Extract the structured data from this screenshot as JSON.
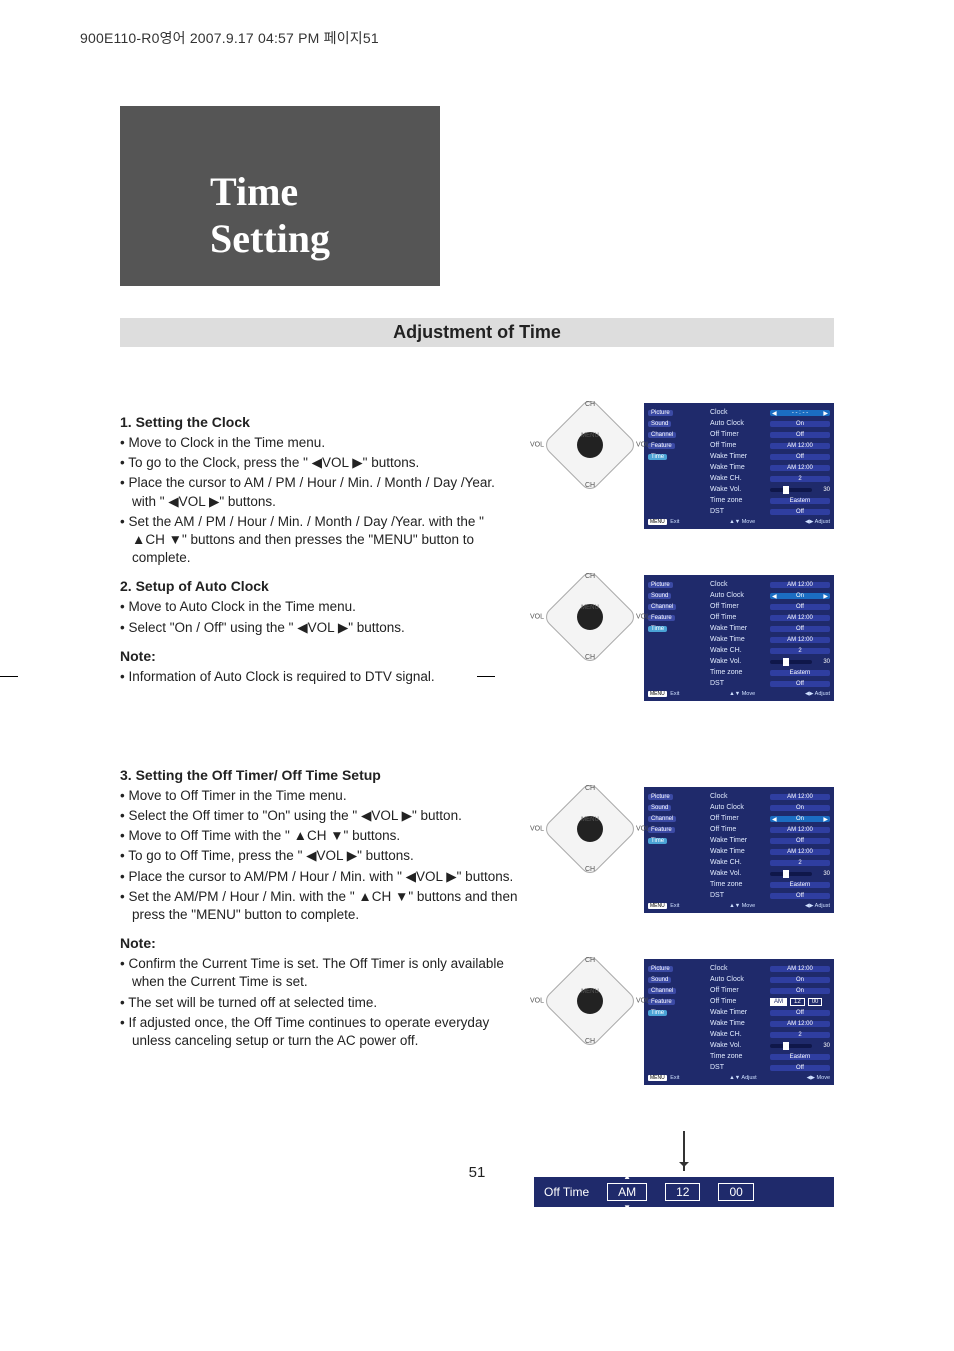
{
  "header_line": "900E110-R0영어  2007.9.17 04:57 PM  페이지51",
  "title": "Time Setting",
  "section_heading": "Adjustment of Time",
  "page_number": "51",
  "remote_labels": {
    "ch_up": "CH",
    "ch_dn": "CH",
    "vol_l": "VOL",
    "vol_r": "VOL",
    "menu": "MENU"
  },
  "step1": {
    "title": "1. Setting the Clock",
    "bullets": [
      "Move to Clock in the Time menu.",
      "To go to the Clock, press the \" ◀VOL ▶\" buttons.",
      "Place the cursor to AM / PM / Hour / Min. / Month / Day /Year. with \" ◀VOL ▶\" buttons.",
      "Set the AM / PM / Hour / Min. / Month / Day /Year. with the \" ▲CH ▼\" buttons and then presses the \"MENU\" button to complete."
    ]
  },
  "step2": {
    "title": "2. Setup of Auto Clock",
    "bullets": [
      "Move to Auto Clock in the Time menu.",
      "Select \"On / Off\" using the  \" ◀VOL ▶\" buttons."
    ],
    "note_label": "Note:",
    "notes": [
      "Information of Auto Clock is required to DTV signal."
    ]
  },
  "step3": {
    "title": "3. Setting the Off Timer/ Off Time Setup",
    "bullets": [
      "Move to Off Timer in the Time menu.",
      "Select the Off timer to \"On\" using the \" ◀VOL ▶\" button.",
      "Move to Off Time with the \" ▲CH ▼\" buttons.",
      "To go to Off Time, press the \" ◀VOL ▶\" buttons.",
      "Place the cursor to AM/PM / Hour / Min. with \" ◀VOL ▶\" buttons.",
      "Set the AM/PM / Hour / Min. with the \" ▲CH ▼\" buttons and then press the \"MENU\" button to complete."
    ],
    "note_label": "Note:",
    "notes": [
      "Confirm the Current Time is set. The Off Timer is only available when the Current Time is set.",
      "The set will be turned off at selected time.",
      "If adjusted once, the Off Time continues to operate everyday unless canceling setup or turn the AC power off."
    ]
  },
  "osd_side_tabs": [
    "Picture",
    "Sound",
    "Channel",
    "Feature",
    "Time"
  ],
  "osd1": {
    "highlight": "Clock",
    "rows": [
      {
        "k": "Clock",
        "v": "- - : - -",
        "hl": true,
        "arrows": true
      },
      {
        "k": "Auto Clock",
        "v": "On"
      },
      {
        "k": "Off Timer",
        "v": "Off"
      },
      {
        "k": "Off Time",
        "v": "AM 12:00"
      },
      {
        "k": "Wake Timer",
        "v": "Off"
      },
      {
        "k": "Wake Time",
        "v": "AM 12:00"
      },
      {
        "k": "Wake CH.",
        "v": "2"
      },
      {
        "k": "Wake Vol.",
        "v": "",
        "slider": true,
        "num": "30"
      },
      {
        "k": "Time zone",
        "v": "Eastern"
      },
      {
        "k": "DST",
        "v": "Off"
      }
    ],
    "footer": {
      "left": "MENU Exit",
      "mid": "▲▼ Move",
      "right": "◀▶ Adjust"
    }
  },
  "osd2": {
    "highlight": "Auto Clock",
    "rows": [
      {
        "k": "Clock",
        "v": "AM 12:00"
      },
      {
        "k": "Auto Clock",
        "v": "On",
        "hl": true,
        "arrows": true
      },
      {
        "k": "Off Timer",
        "v": "Off"
      },
      {
        "k": "Off Time",
        "v": "AM 12:00"
      },
      {
        "k": "Wake Timer",
        "v": "Off"
      },
      {
        "k": "Wake Time",
        "v": "AM 12:00"
      },
      {
        "k": "Wake CH.",
        "v": "2"
      },
      {
        "k": "Wake Vol.",
        "v": "",
        "slider": true,
        "num": "30"
      },
      {
        "k": "Time zone",
        "v": "Eastern"
      },
      {
        "k": "DST",
        "v": "Off"
      }
    ],
    "footer": {
      "left": "MENU Exit",
      "mid": "▲▼ Move",
      "right": "◀▶ Adjust"
    }
  },
  "osd3": {
    "highlight": "Off Timer",
    "rows": [
      {
        "k": "Clock",
        "v": "AM 12:00"
      },
      {
        "k": "Auto Clock",
        "v": "On"
      },
      {
        "k": "Off Timer",
        "v": "On",
        "hl": true,
        "arrows": true
      },
      {
        "k": "Off Time",
        "v": "AM 12:00"
      },
      {
        "k": "Wake Timer",
        "v": "Off"
      },
      {
        "k": "Wake Time",
        "v": "AM 12:00"
      },
      {
        "k": "Wake CH.",
        "v": "2"
      },
      {
        "k": "Wake Vol.",
        "v": "",
        "slider": true,
        "num": "30"
      },
      {
        "k": "Time zone",
        "v": "Eastern"
      },
      {
        "k": "DST",
        "v": "Off"
      }
    ],
    "footer": {
      "left": "MENU Exit",
      "mid": "▲▼ Move",
      "right": "◀▶ Adjust"
    }
  },
  "osd4": {
    "highlight": "Off Time",
    "rows": [
      {
        "k": "Clock",
        "v": "AM 12:00"
      },
      {
        "k": "Auto Clock",
        "v": "On"
      },
      {
        "k": "Off Timer",
        "v": "On"
      },
      {
        "k": "Off Time",
        "v": "AM 12 00",
        "hl": true,
        "boxes": [
          "AM",
          "12",
          "00"
        ]
      },
      {
        "k": "Wake Timer",
        "v": "Off"
      },
      {
        "k": "Wake Time",
        "v": "AM 12:00"
      },
      {
        "k": "Wake CH.",
        "v": "2"
      },
      {
        "k": "Wake Vol.",
        "v": "",
        "slider": true,
        "num": "30"
      },
      {
        "k": "Time zone",
        "v": "Eastern"
      },
      {
        "k": "DST",
        "v": "Off"
      }
    ],
    "footer": {
      "left": "MENU Exit",
      "mid": "▲▼ Adjust",
      "right": "◀▶ Move"
    }
  },
  "offtime_strip": {
    "label": "Off Time",
    "boxes": [
      "AM",
      "12",
      "00"
    ],
    "selected_index": 0
  }
}
